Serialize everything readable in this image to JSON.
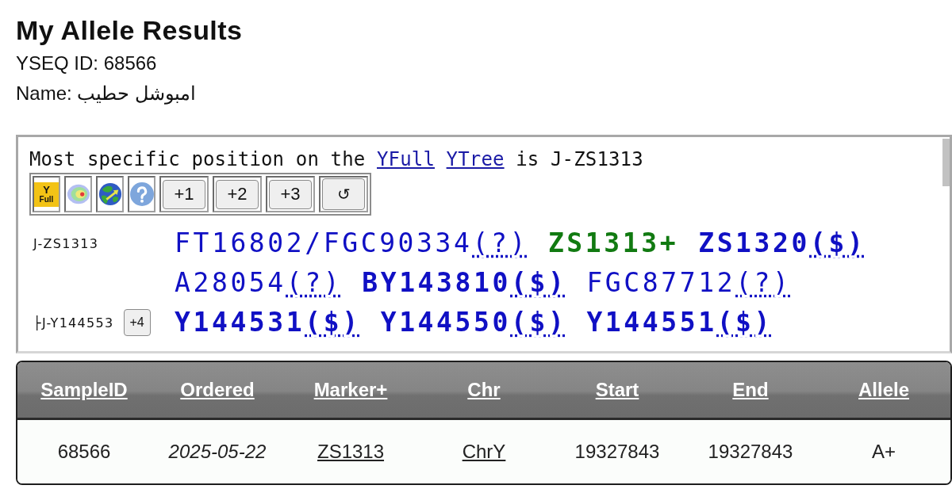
{
  "page": {
    "title": "My Allele Results",
    "info_lines": [
      "YSEQ ID: 68566",
      "Name: امبوشل حطيب"
    ]
  },
  "tree_panel": {
    "intro": {
      "before": "Most specific position on the",
      "links": [
        "YFull",
        "YTree"
      ],
      "after": "is J-ZS1313"
    },
    "toolbar": [
      {
        "kind": "logo",
        "mark": "Y",
        "text": "Full"
      },
      {
        "kind": "heatmap"
      },
      {
        "kind": "globe"
      },
      {
        "kind": "help"
      },
      {
        "kind": "button",
        "label": "+1"
      },
      {
        "kind": "button",
        "label": "+2"
      },
      {
        "kind": "button",
        "label": "+3"
      },
      {
        "kind": "reset",
        "label": "↺"
      }
    ],
    "branches": [
      {
        "label": "J-ZS1313",
        "markers": [
          {
            "kind": "unknown",
            "name": "FT16802/FGC90334",
            "note": "(?)"
          },
          {
            "kind": "positive",
            "name": "ZS1313+"
          },
          {
            "kind": "available",
            "name": "ZS1320",
            "note": "($)"
          },
          {
            "kind": "unknown",
            "name": "A28054",
            "note": "(?)"
          },
          {
            "kind": "available",
            "name": "BY143810",
            "note": "($)"
          },
          {
            "kind": "unknown",
            "name": "FGC87712",
            "note": "(?)"
          }
        ]
      },
      {
        "label": "├J-Y144553",
        "expand": "+4",
        "markers": [
          {
            "kind": "available",
            "name": "Y144531",
            "note": "($)"
          },
          {
            "kind": "available",
            "name": "Y144550",
            "note": "($)"
          },
          {
            "kind": "available",
            "name": "Y144551",
            "note": "($)"
          }
        ]
      }
    ]
  },
  "table": {
    "columns": [
      "SampleID",
      "Ordered",
      "Marker+",
      "Chr",
      "Start",
      "End",
      "Allele"
    ],
    "rows": [
      {
        "cells": [
          {
            "kind": "text",
            "value": "68566"
          },
          {
            "kind": "date",
            "value": "2025-05-22"
          },
          {
            "kind": "link",
            "value": "ZS1313"
          },
          {
            "kind": "link",
            "value": "ChrY"
          },
          {
            "kind": "text",
            "value": "19327843"
          },
          {
            "kind": "text",
            "value": "19327843"
          },
          {
            "kind": "text",
            "value": "A+"
          }
        ]
      }
    ]
  }
}
